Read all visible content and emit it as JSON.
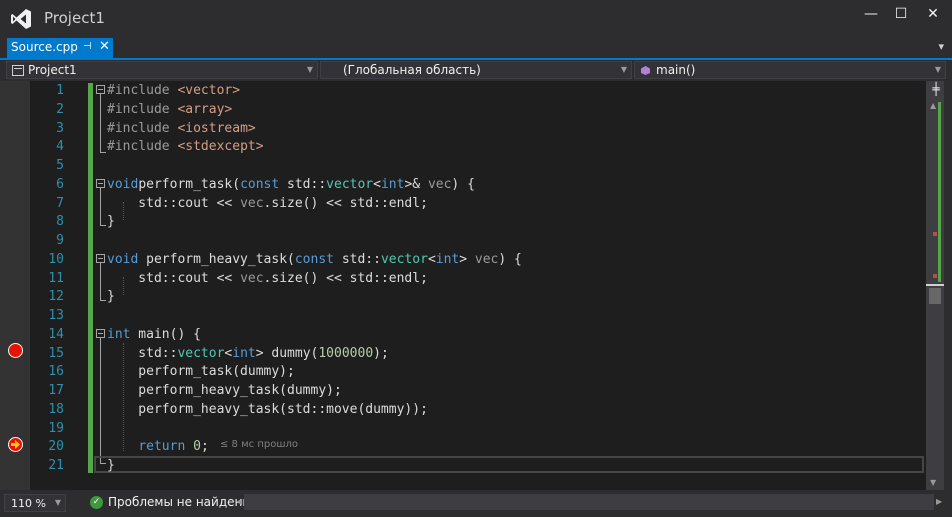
{
  "window": {
    "title": "Project1",
    "minimize": "—",
    "maximize": "☐",
    "close": "✕"
  },
  "tab": {
    "label": "Source.cpp",
    "pin": "⊣",
    "close": "✕",
    "overflow": "▾"
  },
  "navbar": {
    "project": "Project1",
    "scope": "(Глобальная область)",
    "member": "main()"
  },
  "editor": {
    "line_numbers": [
      "1",
      "2",
      "3",
      "4",
      "5",
      "6",
      "7",
      "8",
      "9",
      "10",
      "11",
      "12",
      "13",
      "14",
      "15",
      "16",
      "17",
      "18",
      "19",
      "20",
      "21"
    ],
    "breakpoint_line": "15",
    "current_line": "20",
    "perf_hint": "≤ 8 мс прошло",
    "lines": [
      {
        "n": 1,
        "html_parts": [
          [
            "pp",
            "#include "
          ],
          [
            "str",
            "<vector>"
          ]
        ]
      },
      {
        "n": 2,
        "html_parts": [
          [
            "pp",
            "#include "
          ],
          [
            "str",
            "<array>"
          ]
        ]
      },
      {
        "n": 3,
        "html_parts": [
          [
            "pp",
            "#include "
          ],
          [
            "str",
            "<iostream>"
          ]
        ]
      },
      {
        "n": 4,
        "html_parts": [
          [
            "pp",
            "#include "
          ],
          [
            "str",
            "<stdexcept>"
          ]
        ]
      },
      {
        "n": 5,
        "html_parts": []
      },
      {
        "n": 6,
        "html_parts": [
          [
            "kw",
            "void"
          ],
          [
            "",
            "perform_task("
          ],
          [
            "kw",
            "const"
          ],
          [
            "",
            " std::"
          ],
          [
            "ty",
            "vector"
          ],
          [
            "",
            "<"
          ],
          [
            "kw",
            "int"
          ],
          [
            "",
            ">& "
          ],
          [
            "prm",
            "vec"
          ],
          [
            "",
            ") {"
          ]
        ]
      },
      {
        "n": 7,
        "html_parts": [
          [
            "",
            "    std::cout << "
          ],
          [
            "prm",
            "vec"
          ],
          [
            "",
            ".size() << std::endl;"
          ]
        ]
      },
      {
        "n": 8,
        "html_parts": [
          [
            "",
            "}"
          ]
        ]
      },
      {
        "n": 9,
        "html_parts": []
      },
      {
        "n": 10,
        "html_parts": [
          [
            "kw",
            "void"
          ],
          [
            "",
            " perform_heavy_task("
          ],
          [
            "kw",
            "const"
          ],
          [
            "",
            " std::"
          ],
          [
            "ty",
            "vector"
          ],
          [
            "",
            "<"
          ],
          [
            "kw",
            "int"
          ],
          [
            "",
            "> "
          ],
          [
            "prm",
            "vec"
          ],
          [
            "",
            ") {"
          ]
        ]
      },
      {
        "n": 11,
        "html_parts": [
          [
            "",
            "    std::cout << "
          ],
          [
            "prm",
            "vec"
          ],
          [
            "",
            ".size() << std::endl;"
          ]
        ]
      },
      {
        "n": 12,
        "html_parts": [
          [
            "",
            "}"
          ]
        ]
      },
      {
        "n": 13,
        "html_parts": []
      },
      {
        "n": 14,
        "html_parts": [
          [
            "kw",
            "int"
          ],
          [
            "",
            " main() {"
          ]
        ]
      },
      {
        "n": 15,
        "html_parts": [
          [
            "",
            "    std::"
          ],
          [
            "ty",
            "vector"
          ],
          [
            "",
            "<"
          ],
          [
            "kw",
            "int"
          ],
          [
            "",
            "> dummy("
          ],
          [
            "num",
            "1000000"
          ],
          [
            "",
            ");"
          ]
        ]
      },
      {
        "n": 16,
        "html_parts": [
          [
            "",
            "    perform_task(dummy);"
          ]
        ]
      },
      {
        "n": 17,
        "html_parts": [
          [
            "",
            "    perform_heavy_task(dummy);"
          ]
        ]
      },
      {
        "n": 18,
        "html_parts": [
          [
            "",
            "    perform_heavy_task(std::move(dummy));"
          ]
        ]
      },
      {
        "n": 19,
        "html_parts": []
      },
      {
        "n": 20,
        "html_parts": [
          [
            "",
            "    "
          ],
          [
            "kw",
            "return"
          ],
          [
            "",
            " "
          ],
          [
            "num",
            "0"
          ],
          [
            "",
            ";"
          ]
        ]
      },
      {
        "n": 21,
        "html_parts": [
          [
            "",
            "}"
          ]
        ]
      }
    ]
  },
  "statusbar": {
    "zoom": "110 %",
    "message": "Проблемы не найдены.",
    "ok_icon": "✓"
  },
  "colors": {
    "accent": "#007acc",
    "keyword": "#569cd6",
    "string": "#d69d85",
    "number": "#b5cea8",
    "type": "#4ec9b0",
    "line_number": "#2b91af",
    "change_bar": "#57a64a",
    "breakpoint": "#e51400"
  }
}
